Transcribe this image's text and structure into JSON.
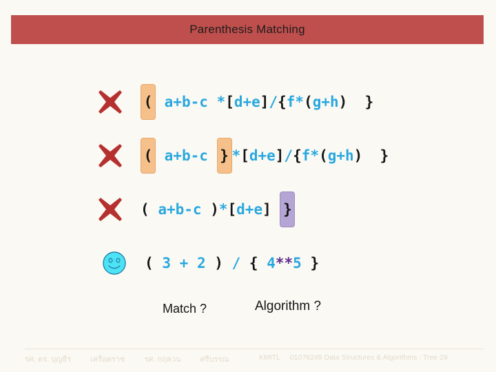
{
  "slide": {
    "title": "Parenthesis Matching"
  },
  "colors": {
    "title_bar": "#bf4f4c",
    "background": "#fbf9f4",
    "token_cyan": "#29a8df",
    "token_black": "#141414",
    "token_purple": "#5b2d8e",
    "highlight_peach": "#f6c08a",
    "highlight_purple": "#b4a5d4",
    "x_mark_red": "#b5312f",
    "smiley_cyan": "#4de3f5",
    "footer_text": "#e3dccc"
  },
  "rows": [
    {
      "status_icon": "x-mark-icon",
      "status": "no-match",
      "expression": "( a+b-c *[d+e]/{f*(g+h)  }",
      "tokens": [
        {
          "text": "(",
          "color": "black",
          "highlight": "peach"
        },
        {
          "text": " ",
          "color": "black",
          "highlight": "none"
        },
        {
          "text": "a+b-c",
          "color": "cyan",
          "highlight": "none"
        },
        {
          "text": " ",
          "color": "cyan",
          "highlight": "none"
        },
        {
          "text": "*",
          "color": "cyan",
          "highlight": "none"
        },
        {
          "text": "[",
          "color": "black",
          "highlight": "none"
        },
        {
          "text": "d+e",
          "color": "cyan",
          "highlight": "none"
        },
        {
          "text": "]",
          "color": "black",
          "highlight": "none"
        },
        {
          "text": "/",
          "color": "cyan",
          "highlight": "none"
        },
        {
          "text": "{",
          "color": "black",
          "highlight": "none"
        },
        {
          "text": "f",
          "color": "cyan",
          "highlight": "none"
        },
        {
          "text": "*",
          "color": "cyan",
          "highlight": "none"
        },
        {
          "text": "(",
          "color": "black",
          "highlight": "none"
        },
        {
          "text": "g+h",
          "color": "cyan",
          "highlight": "none"
        },
        {
          "text": ")",
          "color": "black",
          "highlight": "none"
        },
        {
          "text": "  ",
          "color": "black",
          "highlight": "none"
        },
        {
          "text": "}",
          "color": "black",
          "highlight": "none"
        }
      ]
    },
    {
      "status_icon": "x-mark-icon",
      "status": "no-match",
      "expression": "( a+b-c }*[d+e]/{f*(g+h)  }",
      "tokens": [
        {
          "text": "(",
          "color": "black",
          "highlight": "peach"
        },
        {
          "text": " ",
          "color": "black",
          "highlight": "none"
        },
        {
          "text": "a+b-c",
          "color": "cyan",
          "highlight": "none"
        },
        {
          "text": " ",
          "color": "cyan",
          "highlight": "none"
        },
        {
          "text": "}",
          "color": "black",
          "highlight": "peach"
        },
        {
          "text": "*",
          "color": "cyan",
          "highlight": "none"
        },
        {
          "text": "[",
          "color": "black",
          "highlight": "none"
        },
        {
          "text": "d+e",
          "color": "cyan",
          "highlight": "none"
        },
        {
          "text": "]",
          "color": "black",
          "highlight": "none"
        },
        {
          "text": "/",
          "color": "cyan",
          "highlight": "none"
        },
        {
          "text": "{",
          "color": "black",
          "highlight": "none"
        },
        {
          "text": "f",
          "color": "cyan",
          "highlight": "none"
        },
        {
          "text": "*",
          "color": "cyan",
          "highlight": "none"
        },
        {
          "text": "(",
          "color": "black",
          "highlight": "none"
        },
        {
          "text": "g+h",
          "color": "cyan",
          "highlight": "none"
        },
        {
          "text": ")",
          "color": "black",
          "highlight": "none"
        },
        {
          "text": "  ",
          "color": "black",
          "highlight": "none"
        },
        {
          "text": "}",
          "color": "black",
          "highlight": "none"
        }
      ]
    },
    {
      "status_icon": "x-mark-icon",
      "status": "no-match",
      "expression": "( a+b-c )*[d+e] }",
      "tokens": [
        {
          "text": "(",
          "color": "black",
          "highlight": "none"
        },
        {
          "text": " ",
          "color": "black",
          "highlight": "none"
        },
        {
          "text": "a+b-c",
          "color": "cyan",
          "highlight": "none"
        },
        {
          "text": " ",
          "color": "cyan",
          "highlight": "none"
        },
        {
          "text": ")",
          "color": "black",
          "highlight": "none"
        },
        {
          "text": "*",
          "color": "cyan",
          "highlight": "none"
        },
        {
          "text": "[",
          "color": "black",
          "highlight": "none"
        },
        {
          "text": "d+e",
          "color": "cyan",
          "highlight": "none"
        },
        {
          "text": "]",
          "color": "black",
          "highlight": "none"
        },
        {
          "text": " ",
          "color": "black",
          "highlight": "none"
        },
        {
          "text": "}",
          "color": "black",
          "highlight": "purple"
        }
      ]
    },
    {
      "status_icon": "smiley-icon",
      "status": "match",
      "expression": "( 3 + 2 ) / { 4**5 }",
      "tokens": [
        {
          "text": "(",
          "color": "black",
          "highlight": "none"
        },
        {
          "text": " ",
          "color": "black",
          "highlight": "none"
        },
        {
          "text": "3",
          "color": "cyan",
          "highlight": "none"
        },
        {
          "text": " ",
          "color": "cyan",
          "highlight": "none"
        },
        {
          "text": "+",
          "color": "cyan",
          "highlight": "none"
        },
        {
          "text": " ",
          "color": "cyan",
          "highlight": "none"
        },
        {
          "text": "2",
          "color": "cyan",
          "highlight": "none"
        },
        {
          "text": " ",
          "color": "cyan",
          "highlight": "none"
        },
        {
          "text": ")",
          "color": "black",
          "highlight": "none"
        },
        {
          "text": " ",
          "color": "black",
          "highlight": "none"
        },
        {
          "text": "/",
          "color": "cyan",
          "highlight": "none"
        },
        {
          "text": " ",
          "color": "cyan",
          "highlight": "none"
        },
        {
          "text": "{",
          "color": "black",
          "highlight": "none"
        },
        {
          "text": " ",
          "color": "black",
          "highlight": "none"
        },
        {
          "text": "4",
          "color": "cyan",
          "highlight": "none"
        },
        {
          "text": "**",
          "color": "purple",
          "highlight": "none"
        },
        {
          "text": "5",
          "color": "cyan",
          "highlight": "none"
        },
        {
          "text": " ",
          "color": "cyan",
          "highlight": "none"
        },
        {
          "text": "}",
          "color": "black",
          "highlight": "none"
        }
      ]
    }
  ],
  "questions": {
    "match": "Match ?",
    "algorithm": "Algorithm ?"
  },
  "footer": {
    "author1": "รศ. ดร. บุญธีร",
    "author2": "เครือตราช",
    "author3": "รศ. กฤตวน",
    "author4": "ศรีบรรณ",
    "institution": "KMITL",
    "course": "01076249 Data Structures & Algorithms : Tree 29"
  }
}
